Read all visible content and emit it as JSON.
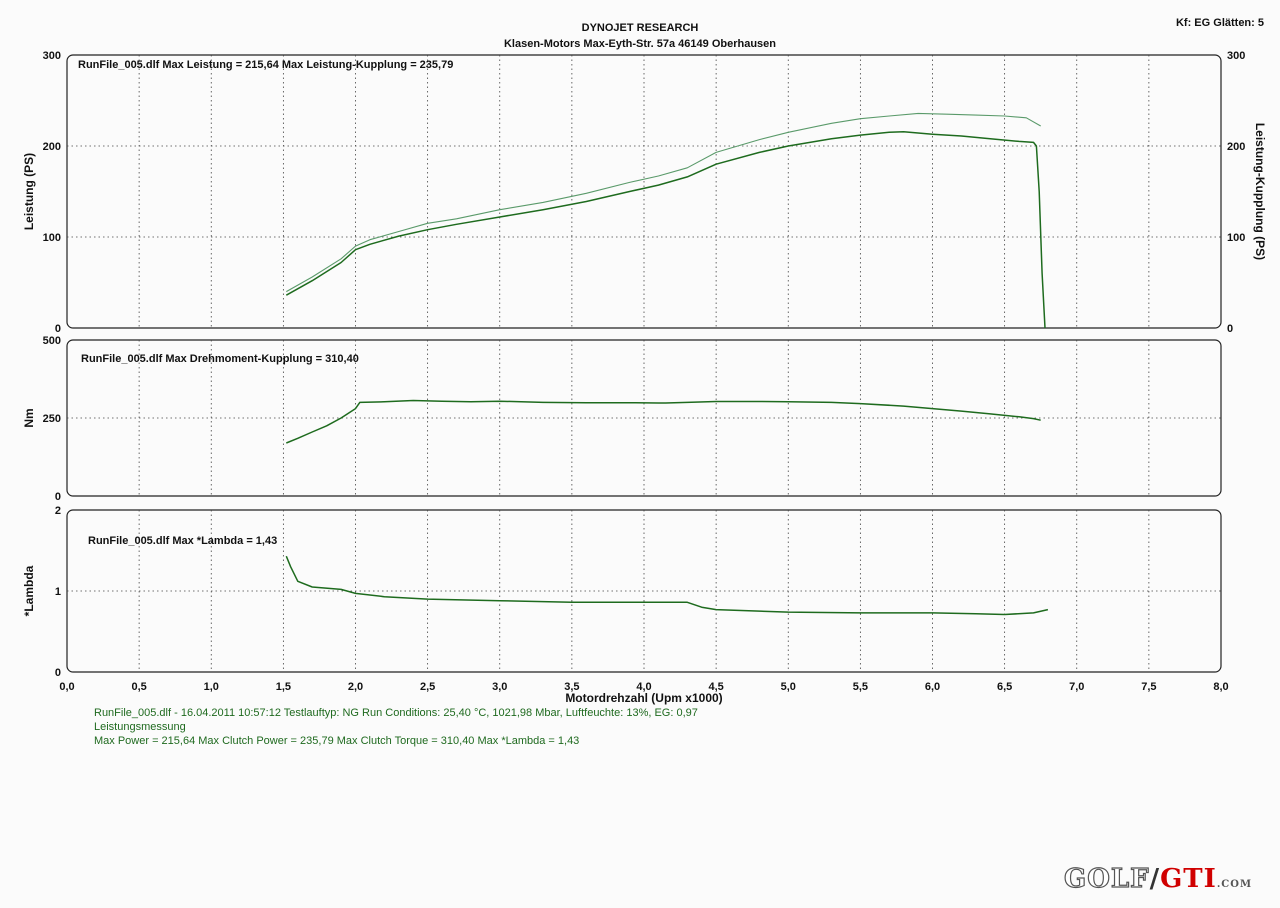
{
  "header": {
    "title": "DYNOJET RESEARCH",
    "address": "Klasen-Motors   Max-Eyth-Str. 57a   46149 Oberhausen",
    "settings": "Kf: EG  Glätten: 5"
  },
  "footer": {
    "line1": "RunFile_005.dlf - 16.04.2011 10:57:12  Testlauftyp: NG  Run Conditions: 25,40 °C, 1021,98 Mbar,  Luftfeuchte: 13%, EG: 0,97",
    "line2": "Leistungsmessung",
    "line3": "Max Power = 215,64  Max Clutch Power = 235,79  Max Clutch Torque = 310,40  Max *Lambda = 1,43"
  },
  "watermark": {
    "text1": "GOLF",
    "slash": "/",
    "text2": "GTI",
    "suffix": ".COM"
  },
  "colors": {
    "series": "#1e6b1e",
    "series_light": "#5a9a6a",
    "frame": "#222222",
    "grid": "#444444"
  },
  "chart_data": [
    {
      "type": "line",
      "annotation": "RunFile_005.dlf Max Leistung = 215,64     Max Leistung-Kupplung = 235,79",
      "ylabel": "Leistung (PS)",
      "ylabel_right": "Leistung-Kupplung (PS)",
      "ylim": [
        0,
        300
      ],
      "yticks": [
        "0",
        "100",
        "200",
        "300"
      ],
      "xlim": [
        0,
        8
      ],
      "grid": true,
      "series": [
        {
          "name": "Leistung",
          "x": [
            1.52,
            1.7,
            1.9,
            2.0,
            2.1,
            2.3,
            2.5,
            2.7,
            3.0,
            3.3,
            3.6,
            3.9,
            4.1,
            4.3,
            4.5,
            4.8,
            5.0,
            5.3,
            5.5,
            5.7,
            5.8,
            6.0,
            6.2,
            6.4,
            6.6,
            6.7,
            6.72,
            6.74,
            6.76,
            6.78
          ],
          "y": [
            36,
            52,
            72,
            86,
            92,
            101,
            108,
            114,
            122,
            130,
            139,
            150,
            157,
            166,
            180,
            193,
            200,
            208,
            212,
            215,
            215.6,
            213,
            211,
            208,
            205,
            204,
            200,
            150,
            60,
            0
          ]
        },
        {
          "name": "Leistung-Kupplung",
          "x": [
            1.52,
            1.7,
            1.9,
            2.0,
            2.1,
            2.3,
            2.5,
            2.7,
            3.0,
            3.3,
            3.6,
            3.9,
            4.1,
            4.3,
            4.5,
            4.8,
            5.0,
            5.3,
            5.5,
            5.7,
            5.9,
            6.1,
            6.3,
            6.5,
            6.65,
            6.75
          ],
          "y": [
            40,
            56,
            76,
            90,
            97,
            106,
            115,
            120,
            130,
            138,
            148,
            160,
            167,
            176,
            193,
            207,
            215,
            225,
            230,
            233,
            235.8,
            235,
            234,
            233,
            231,
            222
          ]
        }
      ]
    },
    {
      "type": "line",
      "annotation": "RunFile_005.dlf Max Drehmoment-Kupplung = 310,40",
      "ylabel": "Nm",
      "ylim": [
        0,
        500
      ],
      "yticks": [
        "0",
        "250",
        "500"
      ],
      "xlim": [
        0,
        8
      ],
      "grid": true,
      "series": [
        {
          "name": "Drehmoment-Kupplung",
          "x": [
            1.52,
            1.6,
            1.7,
            1.8,
            1.9,
            2.0,
            2.03,
            2.2,
            2.4,
            2.6,
            2.8,
            3.0,
            3.3,
            3.6,
            3.9,
            4.1,
            4.15,
            4.3,
            4.5,
            4.8,
            5.0,
            5.3,
            5.5,
            5.8,
            6.0,
            6.2,
            6.4,
            6.6,
            6.7,
            6.75
          ],
          "y": [
            170,
            185,
            205,
            225,
            250,
            280,
            300,
            302,
            306,
            304,
            302,
            304,
            300,
            299,
            299,
            298,
            298,
            300,
            303,
            303,
            302,
            300,
            296,
            288,
            280,
            272,
            263,
            254,
            248,
            243
          ]
        }
      ]
    },
    {
      "type": "line",
      "annotation": "RunFile_005.dlf Max *Lambda = 1,43",
      "ylabel": "*Lambda",
      "ylim": [
        0,
        2
      ],
      "yticks": [
        "0",
        "1",
        "2"
      ],
      "xlim": [
        0,
        8
      ],
      "xlabel": "Motordrehzahl (Upm x1000)",
      "xticks": [
        "0,0",
        "0,5",
        "1,0",
        "1,5",
        "2,0",
        "2,5",
        "3,0",
        "3,5",
        "4,0",
        "4,5",
        "5,0",
        "5,5",
        "6,0",
        "6,5",
        "7,0",
        "7,5",
        "8,0"
      ],
      "grid": true,
      "series": [
        {
          "name": "*Lambda",
          "x": [
            1.52,
            1.55,
            1.6,
            1.7,
            1.9,
            2.0,
            2.2,
            2.5,
            3.0,
            3.5,
            4.0,
            4.3,
            4.4,
            4.5,
            5.0,
            5.5,
            6.0,
            6.3,
            6.5,
            6.7,
            6.8
          ],
          "y": [
            1.43,
            1.3,
            1.12,
            1.05,
            1.02,
            0.97,
            0.93,
            0.9,
            0.88,
            0.86,
            0.86,
            0.86,
            0.8,
            0.77,
            0.74,
            0.73,
            0.73,
            0.72,
            0.71,
            0.73,
            0.77
          ]
        }
      ]
    }
  ]
}
